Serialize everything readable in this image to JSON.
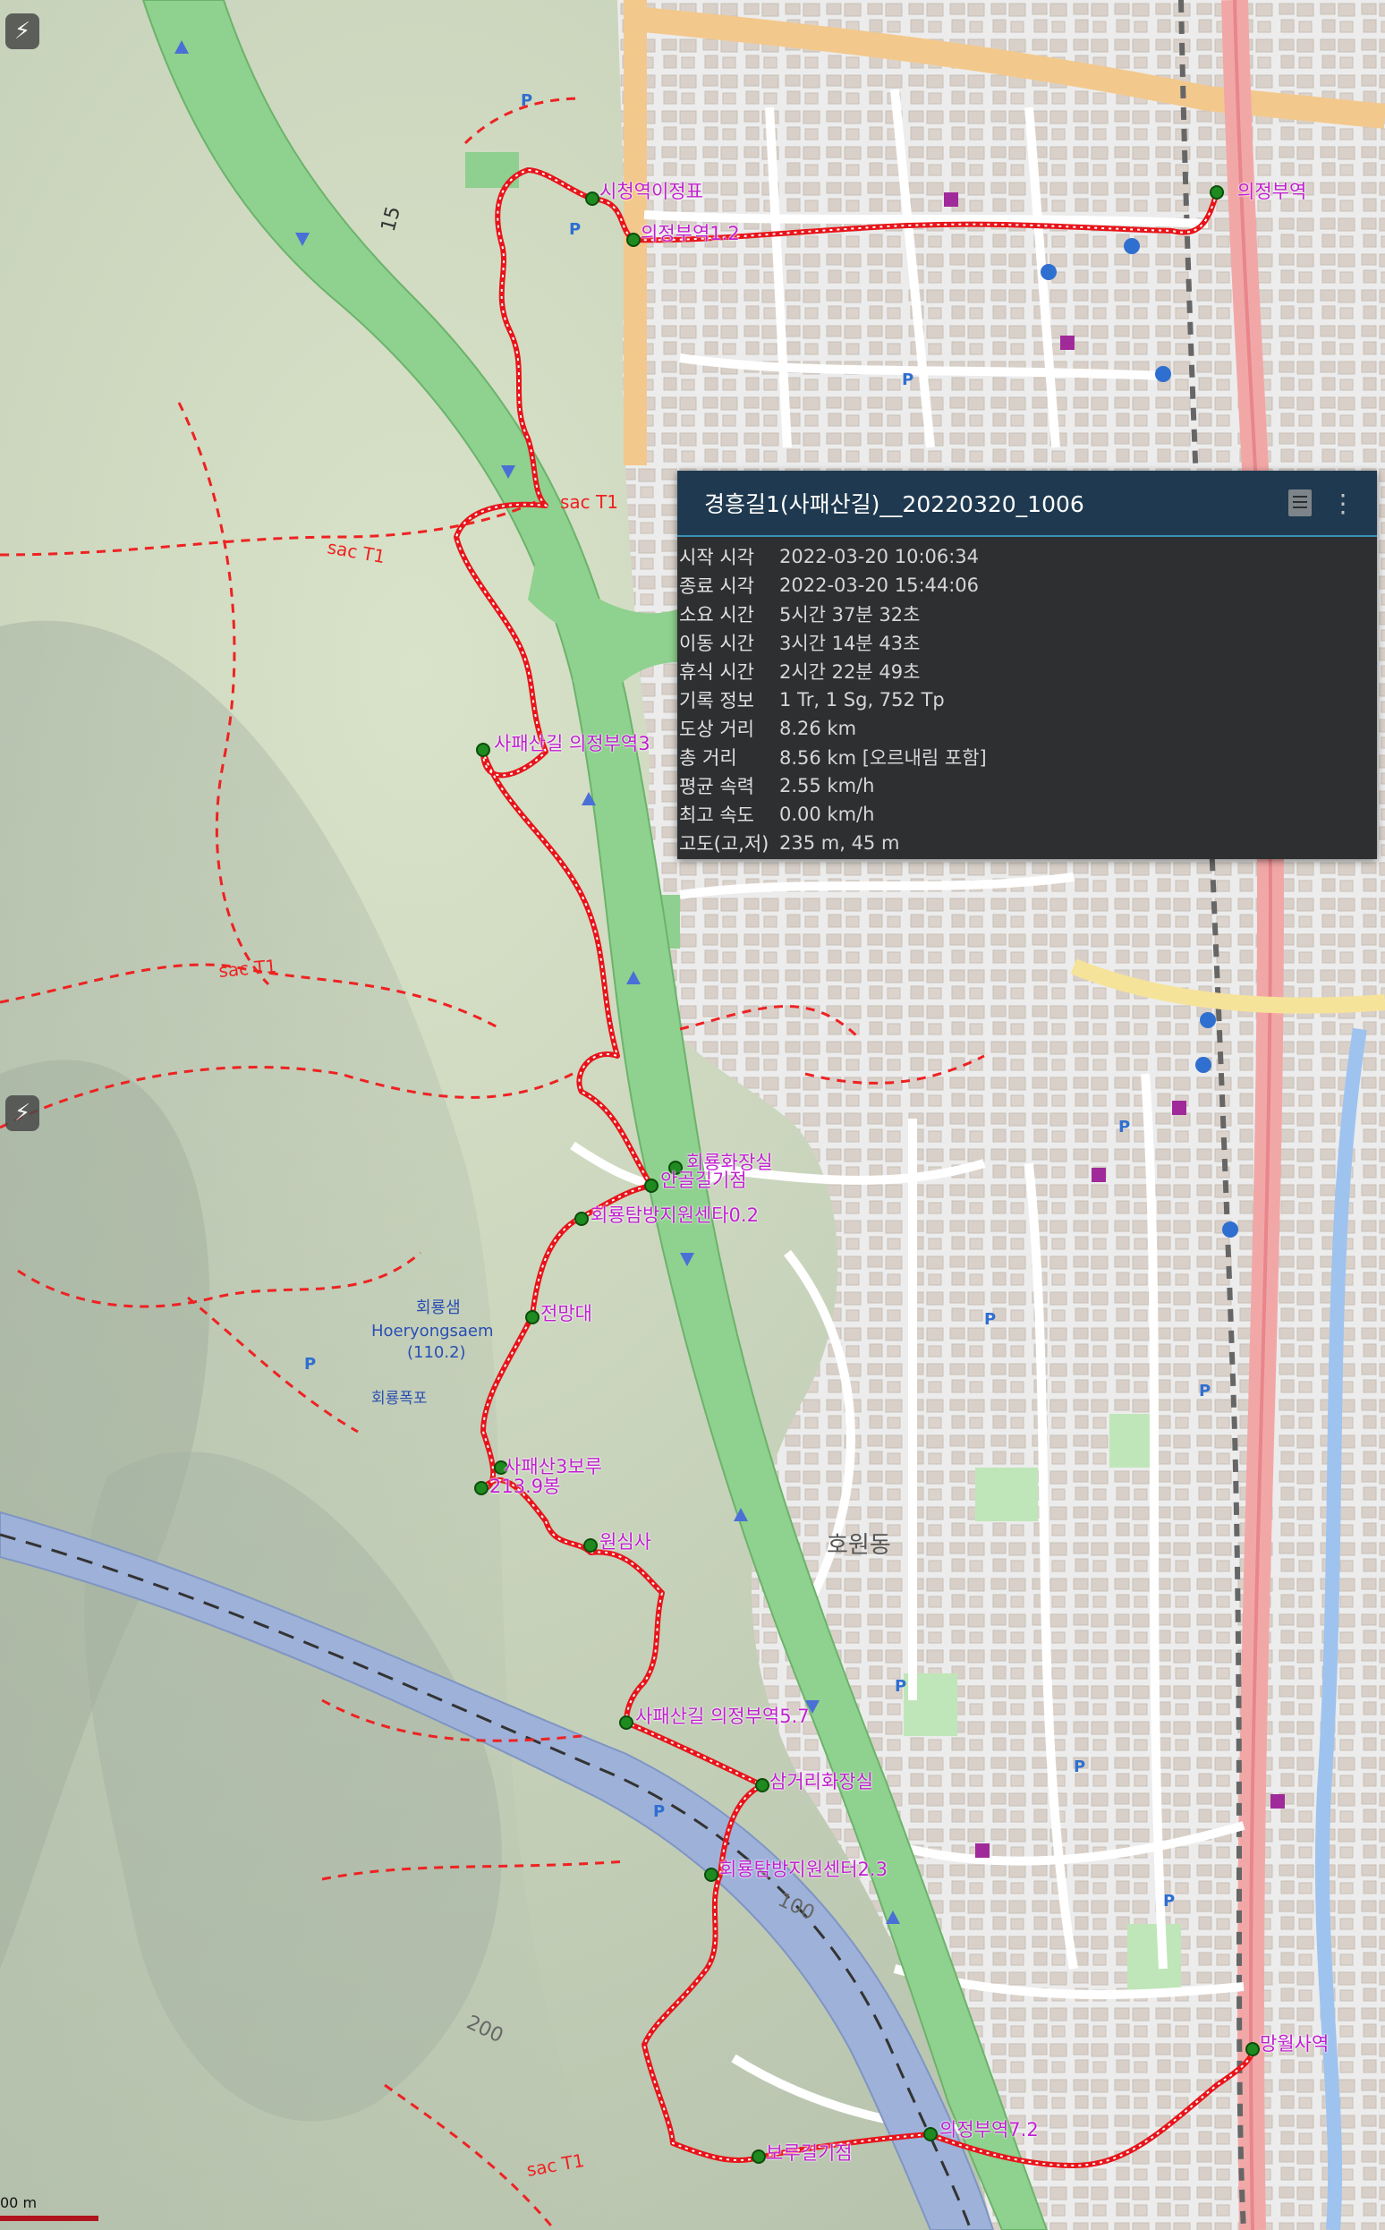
{
  "track_info": {
    "title": "경흥길1(사패산길)__20220320_1006",
    "rows": [
      {
        "label": "시작 시각",
        "value": "2022-03-20 10:06:34"
      },
      {
        "label": "종료 시각",
        "value": "2022-03-20 15:44:06"
      },
      {
        "label": "소요 시간",
        "value": "5시간 37분 32초"
      },
      {
        "label": "이동 시간",
        "value": "3시간 14분 43초"
      },
      {
        "label": "휴식 시간",
        "value": "2시간 22분 49초"
      },
      {
        "label": "기록 정보",
        "value": "1 Tr, 1 Sg, 752 Tp"
      },
      {
        "label": "도상 거리",
        "value": "8.26 km"
      },
      {
        "label": "총 거리",
        "value": "8.56 km [오르내림 포함]"
      },
      {
        "label": "평균 속력",
        "value": "2.55 km/h"
      },
      {
        "label": "최고 속도",
        "value": "0.00 km/h"
      },
      {
        "label": "고도(고,저)",
        "value": "235 m, 45 m"
      }
    ]
  },
  "waypoints": [
    {
      "name": "시청역이정표"
    },
    {
      "name": "의정부역1.2"
    },
    {
      "name": "의정부역"
    },
    {
      "name": "사패산길 의정부역3"
    },
    {
      "name": "회룡화장실"
    },
    {
      "name": "안골길기점"
    },
    {
      "name": "회룡탐방지원센타0.2"
    },
    {
      "name": "전망대"
    },
    {
      "name": "사패산3보루"
    },
    {
      "name": "213.9봉"
    },
    {
      "name": "원심사"
    },
    {
      "name": "사패산길 의정부역5.7"
    },
    {
      "name": "삼거리화장실"
    },
    {
      "name": "회룡탐방지원센터2.3"
    },
    {
      "name": "망월사역"
    },
    {
      "name": "의정부역7.2"
    },
    {
      "name": "보루길기점"
    }
  ],
  "map_labels": {
    "spring_name": "Hoeryongsaem",
    "spring_elev": "(110.2)",
    "spring_kr": "회룡샘",
    "falls_kr": "회룡폭포",
    "district_hoewon": "호원동",
    "contour_100": "100",
    "contour_200": "200",
    "trail_tag": "sac T1",
    "road_15": "15",
    "scale_text": "00 m"
  },
  "colors": {
    "track": "#e8141a",
    "waypoint": "#1f8a1f",
    "label": "#c01fd0",
    "highway": "#8fd18f",
    "river": "#9eb1d8",
    "panel_bg": "#2d2f31",
    "panel_header": "#1f3a50"
  },
  "icons": {
    "left_button_top": "gps-icon",
    "left_button_mid": "gps-icon",
    "header_icon_1": "document-icon",
    "header_icon_2": "more-vert-icon"
  }
}
